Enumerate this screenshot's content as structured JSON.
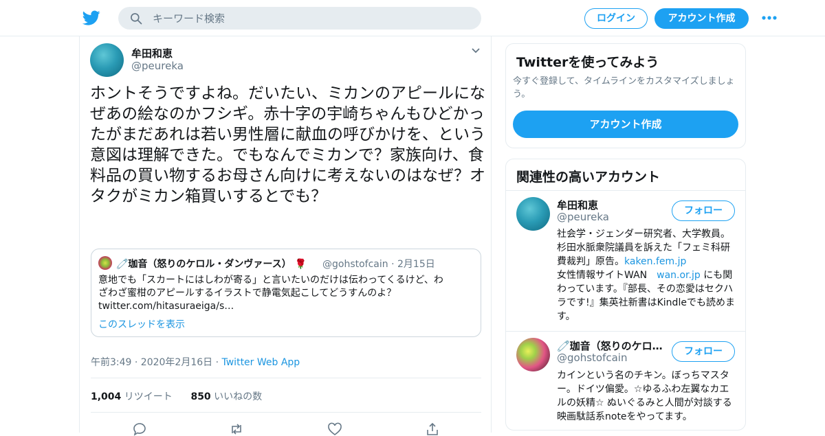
{
  "header": {
    "search_placeholder": "キーワード検索",
    "login_label": "ログイン",
    "signup_label": "アカウント作成"
  },
  "tweet": {
    "author_name": "牟田和恵",
    "author_handle": "@peureka",
    "text": "ホントそうですよね。だいたい、ミカンのアピールになぜあの絵なのかフシギ。赤十字の宇崎ちゃんもひどかったがまだあれは若い男性層に献血の呼びかけを、という意図は理解できた。でもなんでミカンで？家族向け、食料品の買い物するお母さん向けに考えないのはなぜ？オタクがミカン箱買いするとでも？",
    "quote": {
      "name_prefix": "🧷珈音（怒りのケロル・ダンヴァース）",
      "rose": "🌹",
      "handle": "@gohstofcain",
      "sep": "·",
      "date": "2月15日",
      "text_line1": "意地でも「スカートにはしわが寄る」と言いたいのだけは伝わってくるけど、わ",
      "text_line2": "ざわざ蜜柑のアピールするイラストで静電気起こしてどうすんのよ？",
      "text_line3": "twitter.com/hitasuraeiga/s…",
      "thread_link": "このスレッドを表示"
    },
    "timestamp": "午前3:49 · 2020年2月16日",
    "dot": "·",
    "source_app": "Twitter Web App",
    "retweet_count": "1,004",
    "retweet_label": "リツイート",
    "like_count": "850",
    "like_label": "いいねの数"
  },
  "sidebar": {
    "signup_card": {
      "title": "Twitterを使ってみよう",
      "description": "今すぐ登録して、タイムラインをカスタマイズしましょう。",
      "button_label": "アカウント作成"
    },
    "related_card": {
      "title": "関連性の高いアカウント",
      "follow_label": "フォロー",
      "accounts": [
        {
          "name": "牟田和恵",
          "handle": "@peureka",
          "bio_part1": "社会学・ジェンダー研究者、大学教員。杉田水脈衆院議員を訴えた「フェミ科研費裁判」原告。",
          "link1": "kaken.fem.jp",
          "bio_part2": "女性情報サイトWAN　",
          "link2": "wan.or.jp",
          "bio_part3": " にも関わっています。『部長、その恋愛はセクハラです!』集英社新書はKindleでも読めます。"
        },
        {
          "name": "🧷珈音（怒りのケロ…",
          "handle": "@gohstofcain",
          "bio": "カインという名のチキン。ぼっちマスター。ドイツ偏愛。☆ゆるふわ左翼なカエルの妖精☆ ぬいぐるみと人間が対談する映画駄話系noteをやってます。"
        }
      ]
    }
  },
  "colors": {
    "accent": "#1da1f2",
    "link": "#1b95e0",
    "secondary_text": "#657786",
    "border": "#e6ecf0"
  },
  "icons": [
    "twitter-bird-icon",
    "search-icon",
    "more-dots-icon",
    "chevron-down-icon",
    "reply-icon",
    "retweet-icon",
    "like-icon",
    "share-icon"
  ]
}
